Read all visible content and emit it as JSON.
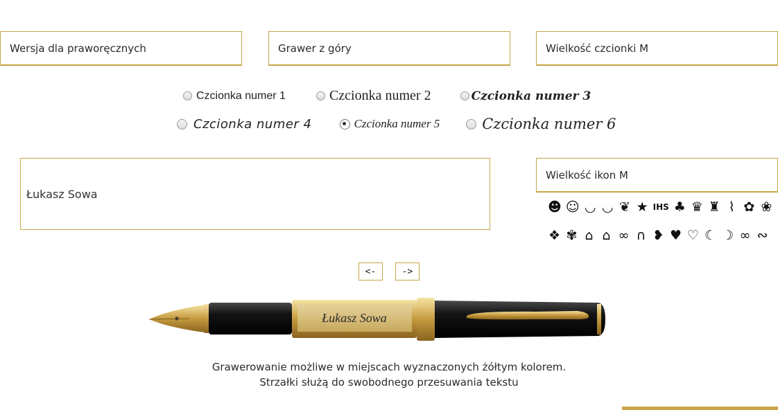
{
  "options": {
    "hand_version": "Wersja dla praworęcznych",
    "engrave_position": "Grawer z góry",
    "font_size": "Wielkość czcionki M",
    "icon_size": "Wielkość ikon M"
  },
  "fonts": [
    {
      "label": "Czcionka numer 1",
      "selected": false
    },
    {
      "label": "Czcionka numer 2",
      "selected": false
    },
    {
      "label": "Czcionka numer 3",
      "selected": false
    },
    {
      "label": "Czcionka numer 4",
      "selected": false
    },
    {
      "label": "Czcionka numer 5",
      "selected": true
    },
    {
      "label": "Czcionka numer 6",
      "selected": false
    }
  ],
  "engraving_text": "Łukasz Sowa",
  "icons_row1": [
    "smile-grin-icon",
    "smile-outline-icon",
    "smile-wide-icon",
    "smile-closed-icon",
    "feather-icon",
    "star-icon",
    "ihs-icon",
    "clover-icon",
    "crown-icon",
    "chess-king-icon",
    "candle-icon",
    "rose-icon",
    "rose-bud-icon"
  ],
  "icons_row2": [
    "paw-icon",
    "flower-icon",
    "graduation-cap-icon",
    "graduation-cap-alt-icon",
    "rings-icon",
    "horseshoe-icon",
    "heart-curved-icon",
    "heart-icon",
    "heart-outline-icon",
    "moon-icon",
    "dove-icon",
    "infinity-icon",
    "infinity-outline-icon"
  ],
  "nav": {
    "prev": "<-",
    "next": "->"
  },
  "pen_engraving": "Łukasz Sowa",
  "hint_line1": "Grawerowanie możliwe w miejscach wyznaczonych żółtym kolorem.",
  "hint_line2": "Strzałki służą do swobodnego przesuwania tekstu",
  "colors": {
    "accent": "#c9a449",
    "pen_body": "#111111",
    "pen_gold": "#d4af5a"
  }
}
